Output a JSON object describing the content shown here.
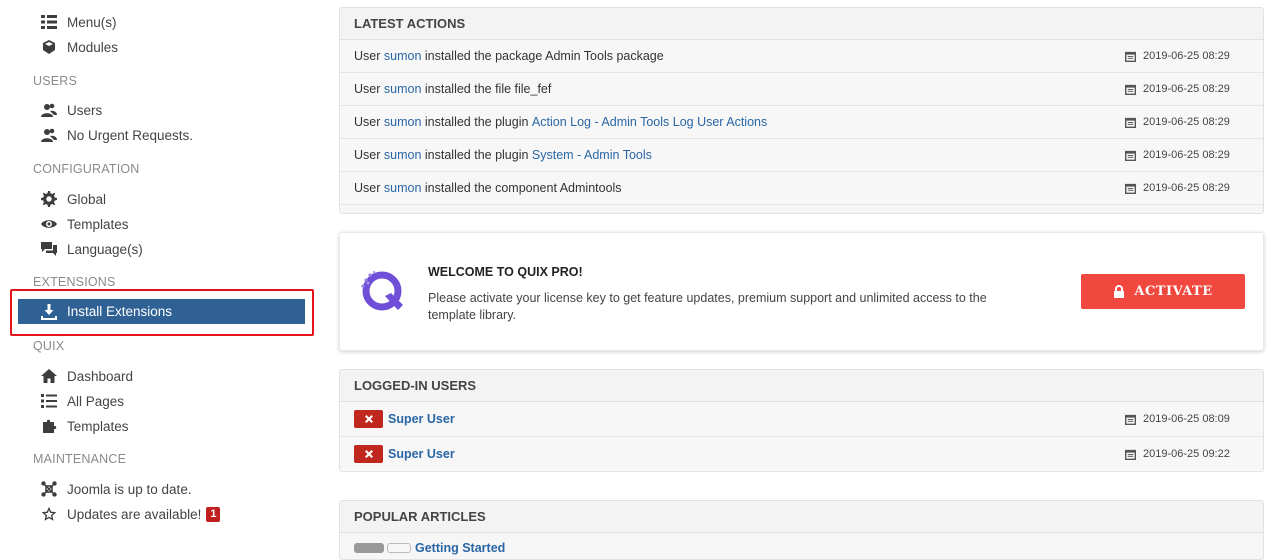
{
  "sidebar": {
    "content_items": [
      {
        "label": "Menu(s)",
        "icon": "list-icon"
      },
      {
        "label": "Modules",
        "icon": "cube-icon"
      }
    ],
    "users": {
      "heading": "USERS",
      "items": [
        {
          "label": "Users",
          "icon": "users-icon"
        },
        {
          "label": "No Urgent Requests.",
          "icon": "users-icon"
        }
      ]
    },
    "configuration": {
      "heading": "CONFIGURATION",
      "items": [
        {
          "label": "Global",
          "icon": "gear-icon"
        },
        {
          "label": "Templates",
          "icon": "eye-icon"
        },
        {
          "label": "Language(s)",
          "icon": "comments-icon"
        }
      ]
    },
    "extensions": {
      "heading": "EXTENSIONS",
      "active_item": {
        "label": "Install Extensions",
        "icon": "download-icon"
      }
    },
    "quix": {
      "heading": "QUIX",
      "items": [
        {
          "label": "Dashboard",
          "icon": "home-icon"
        },
        {
          "label": "All Pages",
          "icon": "list-icon"
        },
        {
          "label": "Templates",
          "icon": "puzzle-icon"
        }
      ]
    },
    "maintenance": {
      "heading": "MAINTENANCE",
      "items": [
        {
          "label": "Joomla is up to date.",
          "icon": "joomla-icon"
        },
        {
          "label": "Updates are available!",
          "icon": "star-icon",
          "badge": "1"
        }
      ]
    }
  },
  "latest_actions": {
    "title": "LATEST ACTIONS",
    "rows": [
      {
        "prefix": "User ",
        "user": "sumon",
        "text": " installed the package Admin Tools package",
        "link": "",
        "date": "2019-06-25 08:29"
      },
      {
        "prefix": "User ",
        "user": "sumon",
        "text": " installed the file file_fef",
        "link": "",
        "date": "2019-06-25 08:29"
      },
      {
        "prefix": "User ",
        "user": "sumon",
        "text": " installed the plugin ",
        "link": "Action Log - Admin Tools Log User Actions",
        "date": "2019-06-25 08:29"
      },
      {
        "prefix": "User ",
        "user": "sumon",
        "text": " installed the plugin ",
        "link": "System - Admin Tools",
        "date": "2019-06-25 08:29"
      },
      {
        "prefix": "User ",
        "user": "sumon",
        "text": " installed the component Admintools",
        "link": "",
        "date": "2019-06-25 08:29"
      }
    ]
  },
  "quix_promo": {
    "title": "WELCOME TO QUIX PRO!",
    "text": "Please activate your license key to get feature updates, premium support and unlimited access to the template library.",
    "button_label": "ACTIVATE",
    "brand_color": "#f0483e",
    "logo_color": "#6f4fd8"
  },
  "logged_in_users": {
    "title": "LOGGED-IN USERS",
    "rows": [
      {
        "name": "Super User",
        "date": "2019-06-25 08:09"
      },
      {
        "name": "Super User",
        "date": "2019-06-25 09:22"
      }
    ]
  },
  "popular_articles": {
    "title": "POPULAR ARTICLES",
    "partial_link": "Getting Started"
  },
  "colors": {
    "sidebar_active": "#2f6195",
    "highlight_outline": "#e3141b",
    "link": "#2a66a5",
    "danger": "#c0281f"
  }
}
